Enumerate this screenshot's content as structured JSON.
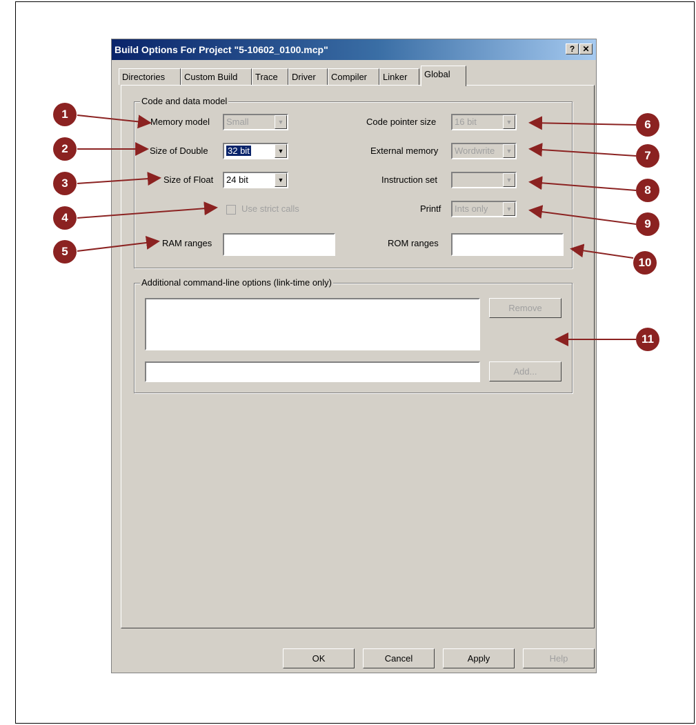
{
  "dialog": {
    "title": "Build Options For Project \"5-10602_0100.mcp\"",
    "help_btn": "?",
    "close_btn": "✕"
  },
  "tabs": [
    "Directories",
    "Custom Build",
    "Trace",
    "Driver",
    "Compiler",
    "Linker",
    "Global"
  ],
  "active_tab": "Global",
  "code_model": {
    "group_title": "Code and data model",
    "memory_model": {
      "label": "Memory model",
      "value": "Small"
    },
    "size_double": {
      "label": "Size of Double",
      "value": "32 bit"
    },
    "size_float": {
      "label": "Size of Float",
      "value": "24 bit"
    },
    "strict_calls": {
      "label": "Use strict calls"
    },
    "ram_ranges": {
      "label": "RAM ranges",
      "value": ""
    },
    "code_pointer": {
      "label": "Code pointer size",
      "value": "16 bit"
    },
    "external_memory": {
      "label": "External memory",
      "value": "Wordwrite"
    },
    "instruction_set": {
      "label": "Instruction set",
      "value": ""
    },
    "printf": {
      "label": "Printf",
      "value": "Ints only"
    },
    "rom_ranges": {
      "label": "ROM ranges",
      "value": ""
    }
  },
  "cmdline": {
    "group_title": "Additional command-line options (link-time only)",
    "remove_btn": "Remove",
    "add_btn": "Add..."
  },
  "footer": {
    "ok": "OK",
    "cancel": "Cancel",
    "apply": "Apply",
    "help": "Help"
  },
  "callouts": [
    "1",
    "2",
    "3",
    "4",
    "5",
    "6",
    "7",
    "8",
    "9",
    "10",
    "11"
  ],
  "colors": {
    "callout": "#8b2221",
    "titlebar": "#0a246a",
    "dialog_bg": "#d4d0c8"
  }
}
